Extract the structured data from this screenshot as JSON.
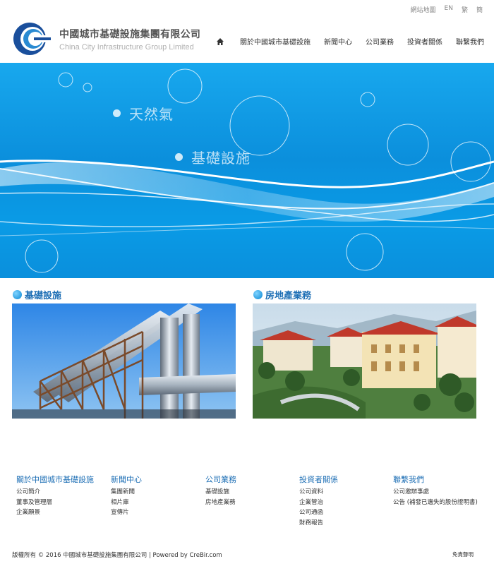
{
  "topbar": {
    "sitemap": "網站地圖",
    "en": "EN",
    "tc": "繁",
    "sc": "簡"
  },
  "logo": {
    "cn": "中國城市基礎設施集團有限公司",
    "en": "China City Infrastructure Group Limited"
  },
  "nav": {
    "home_icon": "home-icon",
    "items": [
      "關於中國城市基礎設施",
      "新聞中心",
      "公司業務",
      "投資者關係",
      "聯繫我們"
    ]
  },
  "banner": {
    "label1": "天然氣",
    "label2": "基礎設施"
  },
  "sections": {
    "left_title": "基礎設施",
    "right_title": "房地產業務"
  },
  "footer": {
    "cols": [
      {
        "heading": "關於中國城市基礎設施",
        "links": [
          "公司簡介",
          "董事及管理層",
          "企業願景"
        ]
      },
      {
        "heading": "新聞中心",
        "links": [
          "集團新聞",
          "相片庫",
          "宣傳片"
        ]
      },
      {
        "heading": "公司業務",
        "links": [
          "基礎設施",
          "房地產業務"
        ]
      },
      {
        "heading": "投資者關係",
        "links": [
          "公司資料",
          "企業管治",
          "公司通函",
          "財務報告"
        ]
      },
      {
        "heading": "聯繫我們",
        "links": [
          "公司邀辦事處",
          "公告 (補發已遺失的股份證明書)"
        ]
      }
    ],
    "copyright": "版權所有 © 2016  中國城市基礎設施集團有限公司 | Powered by CreBir.com",
    "disclaimer": "免責聲明"
  },
  "colors": {
    "accent": "#1e6fb5",
    "banner": "#0a9be6"
  }
}
